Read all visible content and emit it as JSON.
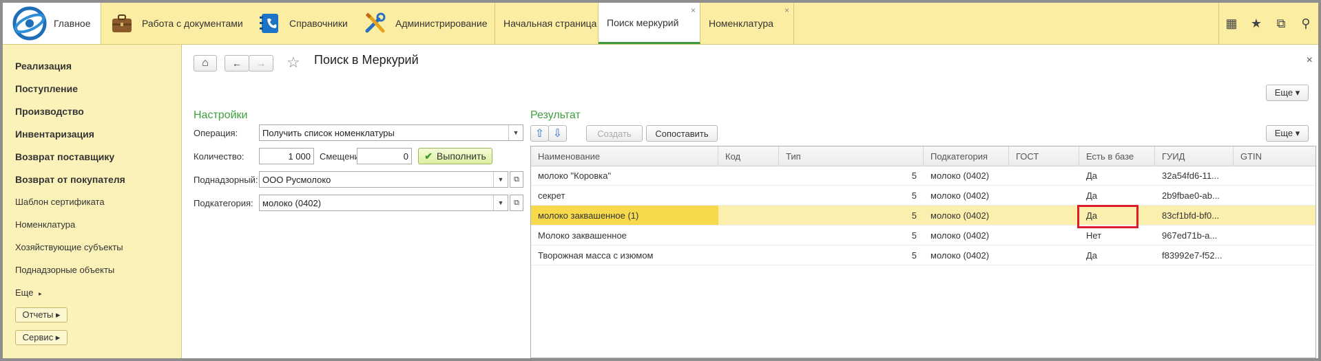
{
  "topbar": {
    "sections": [
      {
        "label": "Главное",
        "icon": "logo-icon"
      },
      {
        "label": "Работа с документами",
        "icon": "briefcase-icon"
      },
      {
        "label": "Справочники",
        "icon": "address-book-icon"
      },
      {
        "label": "Администрирование",
        "icon": "tools-icon"
      }
    ],
    "tabs": [
      {
        "label": "Начальная страница"
      },
      {
        "label": "Поиск меркурий",
        "close": "×"
      },
      {
        "label": "Номенклатура",
        "close": "×"
      }
    ],
    "tools": {
      "grid": "▦",
      "star": "★",
      "history": "⧉",
      "search": "⚲"
    }
  },
  "sidebar": {
    "items": [
      "Реализация",
      "Поступление",
      "Производство",
      "Инвентаризация",
      "Возврат поставщику",
      "Возврат от покупателя",
      "Шаблон сертификата",
      "Номенклатура",
      "Хозяйствующие субъекты",
      "Поднадзорные объекты",
      "Еще"
    ],
    "more_arrow": "▸",
    "reports_button": "Отчеты ▸",
    "service_button": "Сервис ▸"
  },
  "form": {
    "title": "Поиск в Меркурий",
    "home": "⌂",
    "back": "←",
    "forward": "→",
    "star": "☆",
    "close": "×",
    "more_top": "Еще ▾",
    "settings_title": "Настройки",
    "operation_label": "Операция:",
    "operation_value": "Получить список номенклатуры",
    "count_label": "Количество:",
    "count_value": "1 000",
    "offset_label": "Смещение:",
    "offset_value": "0",
    "run_button": "Выполнить",
    "supervised_label": "Поднадзорный:",
    "supervised_value": "ООО Русмолоко",
    "subcategory_label": "Подкатегория:",
    "subcategory_value": "молоко (0402)",
    "result_title": "Результат",
    "up": "⇧",
    "down": "⇩",
    "create_button": "Создать",
    "match_button": "Сопоставить",
    "more_result": "Еще ▾"
  },
  "table": {
    "columns": [
      "Наименование",
      "Код",
      "Тип",
      "Подкатегория",
      "ГОСТ",
      "Есть в базе",
      "ГУИД",
      "GTIN"
    ],
    "rows": [
      {
        "name": "молоко \"Коровка\"",
        "code": "",
        "type": "5",
        "subcat": "молоко (0402)",
        "gost": "",
        "in_base": "Да",
        "guid": "32a54fd6-11...",
        "gtin": ""
      },
      {
        "name": "секрет",
        "code": "",
        "type": "5",
        "subcat": "молоко (0402)",
        "gost": "",
        "in_base": "Да",
        "guid": "2b9fbae0-ab...",
        "gtin": ""
      },
      {
        "name": "молоко заквашенное (1)",
        "code": "",
        "type": "5",
        "subcat": "молоко (0402)",
        "gost": "",
        "in_base": "Да",
        "guid": "83cf1bfd-bf0...",
        "gtin": ""
      },
      {
        "name": "Молоко заквашенное",
        "code": "",
        "type": "5",
        "subcat": "молоко (0402)",
        "gost": "",
        "in_base": "Нет",
        "guid": "967ed71b-a...",
        "gtin": ""
      },
      {
        "name": "Творожная масса с изюмом",
        "code": "",
        "type": "5",
        "subcat": "молоко (0402)",
        "gost": "",
        "in_base": "Да",
        "guid": "f83992e7-f52...",
        "gtin": ""
      }
    ],
    "selected_row": 2
  },
  "colors": {
    "accent_green": "#3e9f3e",
    "highlight_red": "#e01b2b",
    "section_bar": "#fbeea3"
  }
}
